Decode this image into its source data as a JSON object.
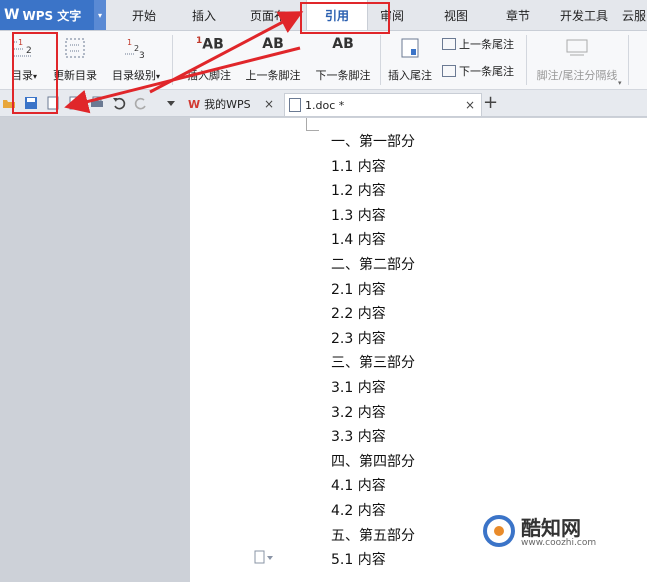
{
  "app": {
    "logo": "W",
    "title": "WPS 文字",
    "menu_arrow": "▾"
  },
  "menu_tabs": [
    {
      "label": "开始"
    },
    {
      "label": "插入"
    },
    {
      "label": "页面布"
    },
    {
      "label": "引用"
    },
    {
      "label": "审阅"
    },
    {
      "label": "视图"
    },
    {
      "label": "章节"
    },
    {
      "label": "开发工具"
    },
    {
      "label": "云服"
    }
  ],
  "ribbon": {
    "toc": "目录",
    "update_toc": "更新目录",
    "toc_level": "目录级别",
    "insert_footnote": "插入脚注",
    "prev_footnote": "上一条脚注",
    "next_footnote": "下一条脚注",
    "insert_endnote": "插入尾注",
    "prev_endnote": "上一条尾注",
    "next_endnote": "下一条尾注",
    "separator": "脚注/尾注分隔线",
    "ab_glyph": "AB",
    "toc_glyph_1": "1",
    "toc_glyph_2": "2",
    "toc_glyph_3": "3",
    "fn_sup": "1",
    "dropdown": "▾",
    "dropdown_small": "▾"
  },
  "doc_tabs": {
    "home": {
      "label": "我的WPS",
      "close": "×"
    },
    "doc": {
      "label": "1.doc *",
      "close": "×"
    },
    "plus": "+"
  },
  "document": {
    "lines": [
      "一、第一部分",
      "1.1 内容",
      "1.2 内容",
      "1.3 内容",
      "1.4 内容",
      "二、第二部分",
      "2.1 内容",
      "2.2 内容",
      "2.3 内容",
      "三、第三部分",
      "3.1 内容",
      "3.2 内容",
      "3.3 内容",
      "四、第四部分",
      "4.1 内容",
      "4.2 内容",
      "五、第五部分",
      "5.1 内容"
    ]
  },
  "watermark": {
    "name": "酷知网",
    "url": "www.coozhi.com"
  },
  "colors": {
    "accent": "#3b74c8",
    "annotation": "#e0262a"
  }
}
